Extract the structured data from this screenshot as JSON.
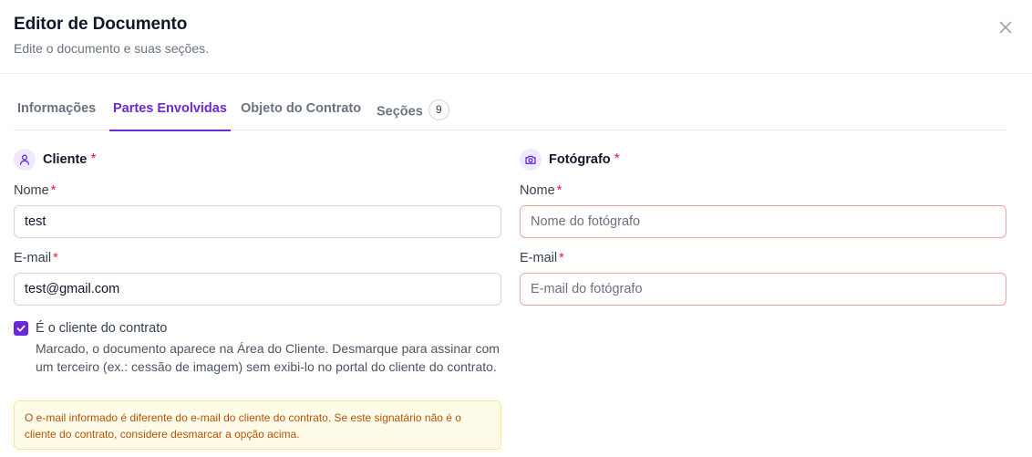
{
  "dialog": {
    "title": "Editor de Documento",
    "subtitle": "Edite o documento e suas seções."
  },
  "tabs": [
    {
      "label": "Informações",
      "active": false
    },
    {
      "label": "Partes Envolvidas",
      "active": true
    },
    {
      "label": "Objeto do Contrato",
      "active": false
    },
    {
      "label": "Seções",
      "badge": "9",
      "active": false
    }
  ],
  "client": {
    "title": "Cliente",
    "required_mark": "*",
    "icon": "user-icon",
    "name_label": "Nome",
    "name_value": "test",
    "email_label": "E-mail",
    "email_value": "test@gmail.com",
    "checkbox_checked": true,
    "checkbox_label": "É o cliente do contrato",
    "checkbox_description": "Marcado, o documento aparece na Área do Cliente. Desmarque para assinar com um terceiro (ex.: cessão de imagem) sem exibi-lo no portal do cliente do contrato.",
    "warning": "O e-mail informado é diferente do e-mail do cliente do contrato. Se este signatário não é o cliente do contrato, considere desmarcar a opção acima."
  },
  "photographer": {
    "title": "Fotógrafo",
    "required_mark": "*",
    "icon": "camera-icon",
    "name_label": "Nome",
    "name_placeholder": "Nome do fotógrafo",
    "email_label": "E-mail",
    "email_placeholder": "E-mail do fotógrafo"
  },
  "colors": {
    "accent": "#6d28d9",
    "required": "#e11d48",
    "warning_text": "#b45309",
    "warning_bg": "#fefce8",
    "error_border": "#f0a3a3"
  }
}
